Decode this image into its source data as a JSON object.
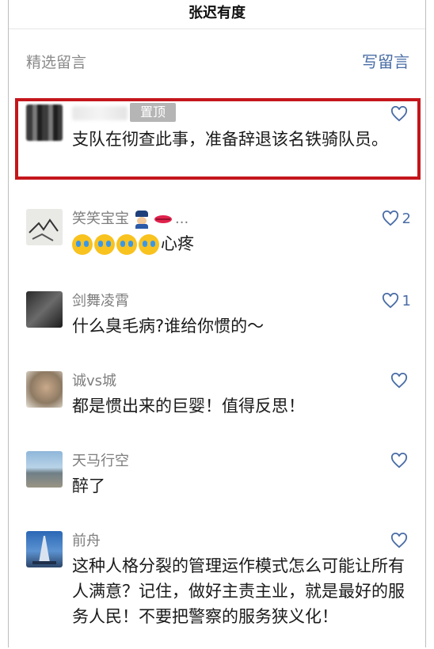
{
  "top_title": "张迟有度",
  "section": {
    "title": "精选留言",
    "write_label": "写留言"
  },
  "colors": {
    "accent": "#4a6da6",
    "highlight": "#c4161c",
    "badge": "#b5b5b5"
  },
  "comments": [
    {
      "nickname": "",
      "badge": "置顶",
      "text": "支队在彻查此事，准备辞退该名铁骑队员。",
      "likes": "",
      "highlighted": true
    },
    {
      "nickname": "笑笑宝宝",
      "nickname_suffix": "...",
      "text": "心疼",
      "likes": "2"
    },
    {
      "nickname": "剑舞凌霄",
      "text": "什么臭毛病?谁给你惯的～",
      "likes": "1"
    },
    {
      "nickname": "诚vs城",
      "text": "都是惯出来的巨婴！值得反思！",
      "likes": ""
    },
    {
      "nickname": "天马行空",
      "text": "醉了",
      "likes": ""
    },
    {
      "nickname": "前舟",
      "text": "这种人格分裂的管理运作模式怎么可能让所有人满意？记住，做好主责主业，就是最好的服务人民！不要把警察的服务狭义化！",
      "likes": ""
    }
  ]
}
